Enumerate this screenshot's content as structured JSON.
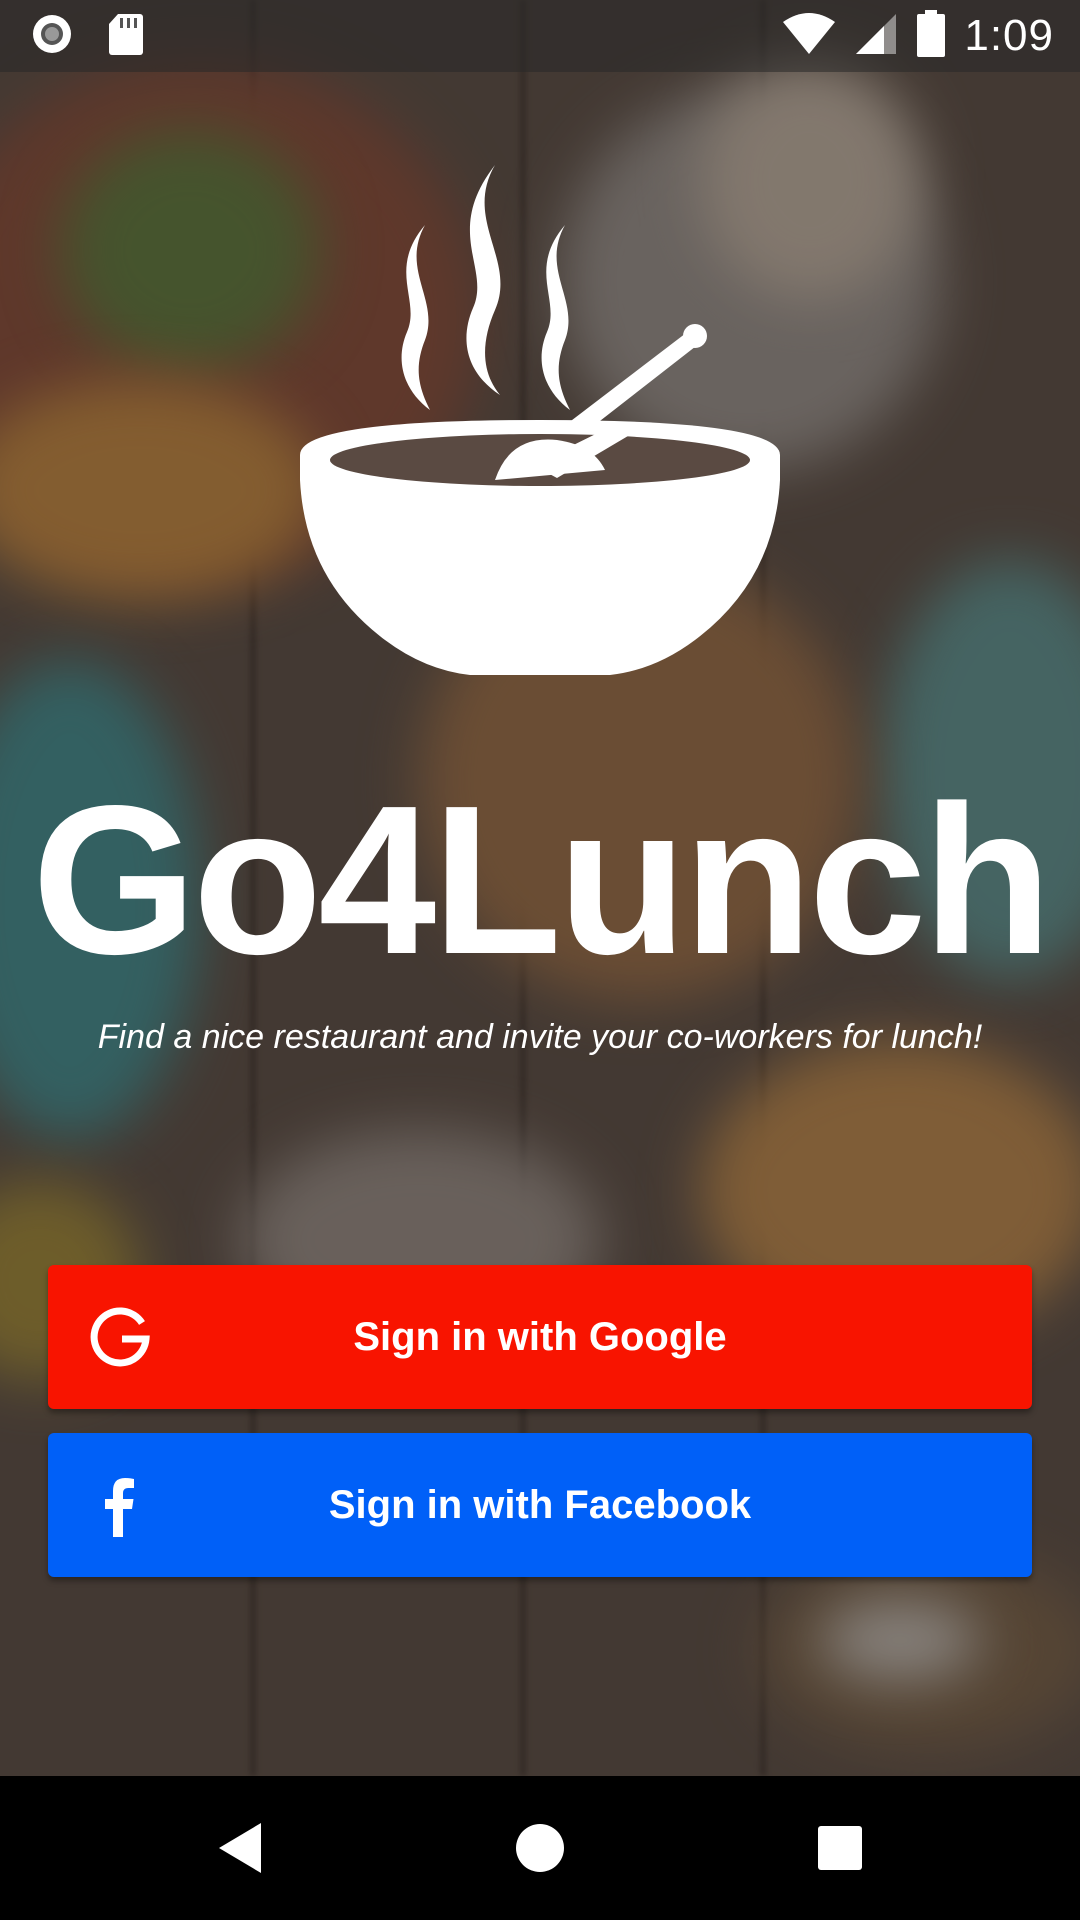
{
  "status_bar": {
    "time": "1:09",
    "icons": [
      "record-icon",
      "sd-card-icon",
      "wifi-icon",
      "signal-icon",
      "battery-icon"
    ]
  },
  "app": {
    "title": "Go4Lunch",
    "tagline": "Find a nice restaurant and invite your co-workers for lunch!",
    "logo_icon": "soup-bowl-icon"
  },
  "buttons": {
    "google": {
      "label": "Sign in with Google",
      "icon": "google-icon",
      "color": "#f81400"
    },
    "facebook": {
      "label": "Sign in with Facebook",
      "icon": "facebook-icon",
      "color": "#0060f8"
    }
  },
  "nav_bar": {
    "icons": [
      "back-icon",
      "home-icon",
      "recents-icon"
    ]
  }
}
